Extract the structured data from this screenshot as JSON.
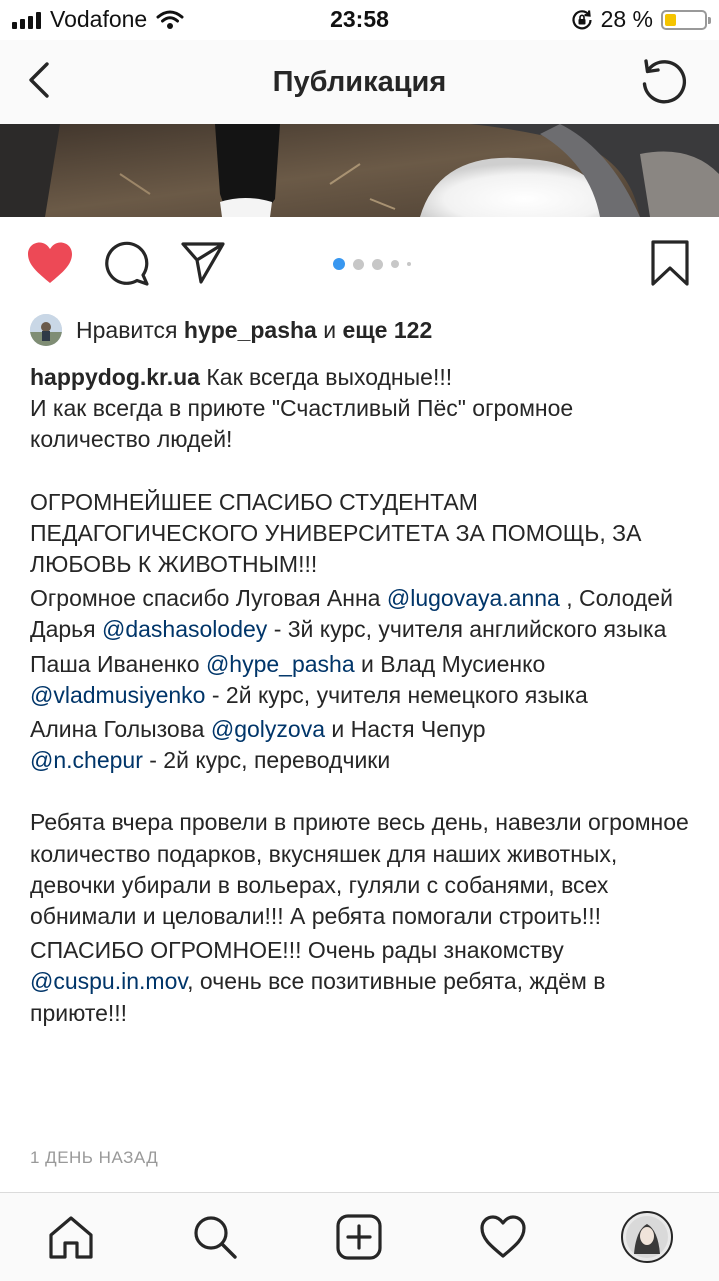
{
  "status_bar": {
    "carrier": "Vodafone",
    "time": "23:58",
    "battery_percent": "28 %",
    "battery_level": 0.28
  },
  "header": {
    "title": "Публикация",
    "back_icon": "chevron-left-icon",
    "refresh_icon": "refresh-icon"
  },
  "post": {
    "carousel_page": 1,
    "carousel_pages": 5,
    "likes": {
      "prefix": "Нравится",
      "user": "hype_pasha",
      "middle": "и",
      "others": "еще 122"
    },
    "caption": {
      "username": "happydog.kr.ua",
      "line1": "Как всегда выходные!!!",
      "line2": "И как всегда в приюте \"Счастливый Пёс\" огромное количество людей!",
      "line3": "ОГРОМНЕЙШЕЕ СПАСИБО СТУДЕНТАМ ПЕДАГОГИЧЕСКОГО УНИВЕРСИТЕТА ЗА ПОМОЩЬ, ЗА ЛЮБОВЬ К ЖИВОТНЫМ!!!",
      "p1_text1": "Огромное спасибо Луговая Анна",
      "p1_mention1": "@lugovaya.anna",
      "p1_text2": ", Солодей Дарья",
      "p1_mention2": "@dashasolodey",
      "p1_text3": "- 3й курс, учителя английского языка",
      "p2_text1": "Паша Иваненко",
      "p2_mention1": "@hype_pasha",
      "p2_text2": "и Влад Мусиенко",
      "p2_mention2": "@vladmusiyenko",
      "p2_text3": "- 2й курс, учителя немецкого языка",
      "p3_text1": "Алина Голызова",
      "p3_mention1": "@golyzova",
      "p3_text2": "и Настя Чепур",
      "p3_mention2": "@n.chepur",
      "p3_text3": "- 2й курс, переводчики",
      "p4": "Ребята вчера провели в приюте весь день, навезли огромное количество подарков, вкусняшек для наших животных, девочки убирали в вольерах, гуляли с собанями, всех обнимали и целовали!!! А ребята помогали строить!!!",
      "p5_text1": "СПАСИБО ОГРОМНОЕ!!! Очень рады знакомству",
      "p5_mention": "@cuspu.in.mov",
      "p5_text2": ", очень все позитивные ребята, ждём в приюте!!!"
    },
    "time_ago": "1 ДЕНЬ НАЗАД"
  },
  "colors": {
    "like_red": "#ed4956",
    "carousel_active": "#3897f0",
    "mention_blue": "#003569",
    "battery_yellow": "#f5c400"
  }
}
